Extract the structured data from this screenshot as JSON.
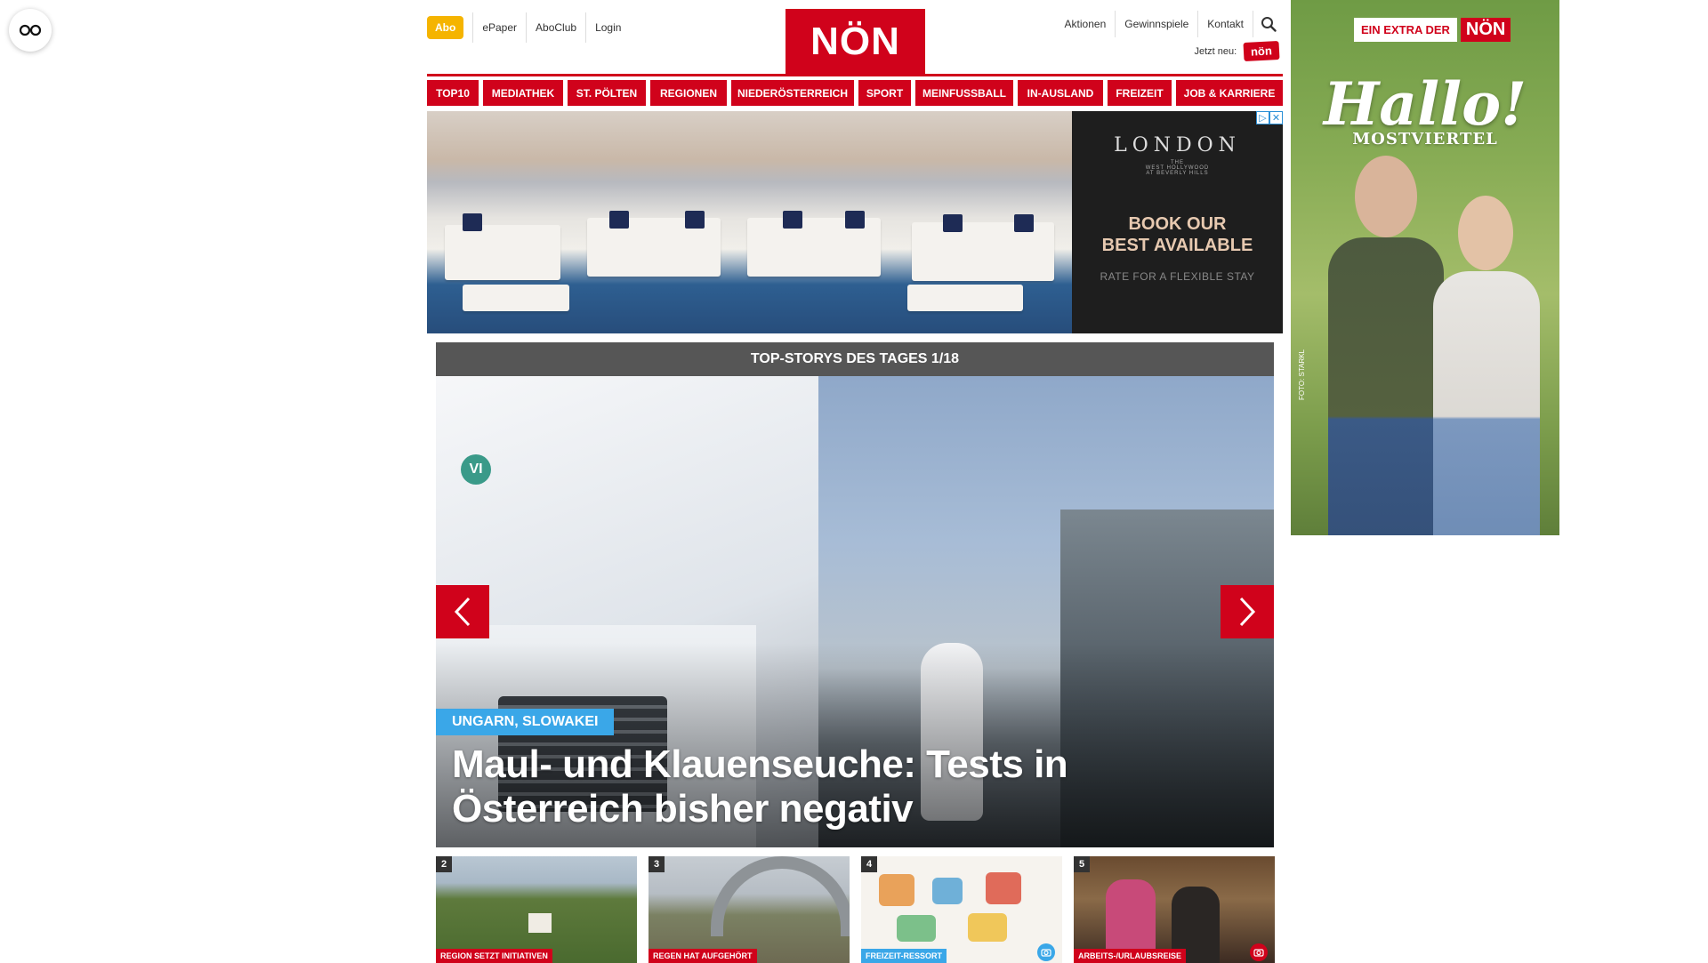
{
  "header": {
    "abo_label": "Abo",
    "meta_left": [
      "ePaper",
      "AboClub",
      "Login"
    ],
    "logo_text": "NÖN",
    "meta_right": [
      "Aktionen",
      "Gewinnspiele",
      "Kontakt"
    ],
    "jetzt_neu_label": "Jetzt neu:",
    "jetzt_neu_badge": "nön"
  },
  "nav": {
    "items": [
      "TOP10",
      "MEDIATHEK",
      "ST. PÖLTEN",
      "REGIONEN",
      "NIEDERÖSTERREICH",
      "SPORT",
      "MEINFUSSBALL",
      "IN-AUSLAND",
      "FREIZEIT",
      "JOB & KARRIERE"
    ]
  },
  "banner_ad": {
    "brand": "LONDON",
    "brand_sub": "THE\nWEST HOLLYWOOD\nAT BEVERLY HILLS",
    "headline": "BOOK OUR\nBEST AVAILABLE",
    "subline": "RATE FOR A FLEXIBLE STAY"
  },
  "top_stories": {
    "heading": "TOP-STORYS DES TAGES 1/18",
    "slide_tag": "UNGARN, SLOWAKEI",
    "slide_title": "Maul- und Klauenseuche: Tests in Österreich bisher negativ",
    "slide_badge": "VI"
  },
  "thumbnails": [
    {
      "num": "2",
      "tag": "REGION SETZT INITIATIVEN",
      "tag_color": "red"
    },
    {
      "num": "3",
      "tag": "REGEN HAT AUFGEHÖRT",
      "tag_color": "red"
    },
    {
      "num": "4",
      "tag": "FREIZEIT-RESSORT",
      "tag_color": "blue"
    },
    {
      "num": "5",
      "tag": "ARBEITS-/URLAUBSREISE",
      "tag_color": "red"
    }
  ],
  "side_ad": {
    "extra_label": "EIN EXTRA DER",
    "logo": "NÖN",
    "hallo": "Hallo!",
    "region": "MOSTVIERTEL",
    "credit": "FOTO: STARKL"
  },
  "colors": {
    "brand_red": "#d0021b",
    "abo_yellow": "#f5b400",
    "tag_blue": "#3aa7e8"
  }
}
